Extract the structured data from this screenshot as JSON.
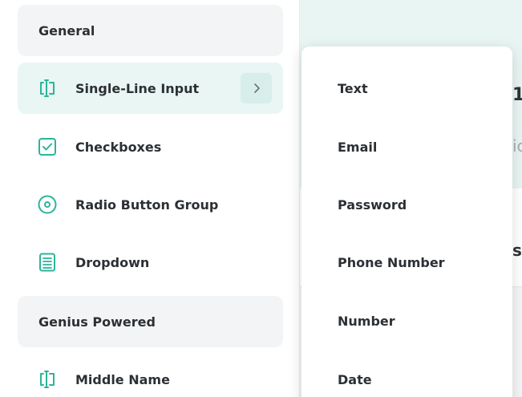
{
  "sidebar": {
    "sections": [
      {
        "title": "General"
      },
      {
        "title": "Genius Powered"
      }
    ],
    "items": [
      {
        "label": "Single-Line Input",
        "icon": "text-cursor-icon",
        "active": true
      },
      {
        "label": "Checkboxes",
        "icon": "checkbox-icon",
        "active": false
      },
      {
        "label": "Radio Button Group",
        "icon": "radio-icon",
        "active": false
      },
      {
        "label": "Dropdown",
        "icon": "dropdown-list-icon",
        "active": false
      },
      {
        "label": "Middle Name",
        "icon": "text-cursor-icon",
        "active": false
      }
    ]
  },
  "submenu": {
    "items": [
      {
        "label": "Text"
      },
      {
        "label": "Email"
      },
      {
        "label": "Password"
      },
      {
        "label": "Phone Number"
      },
      {
        "label": "Number"
      },
      {
        "label": "Date"
      }
    ]
  },
  "colors": {
    "accent": "#2bb59a",
    "active_bg": "#e9f6f3",
    "section_bg": "#f3f4f5",
    "text": "#2c3034"
  }
}
